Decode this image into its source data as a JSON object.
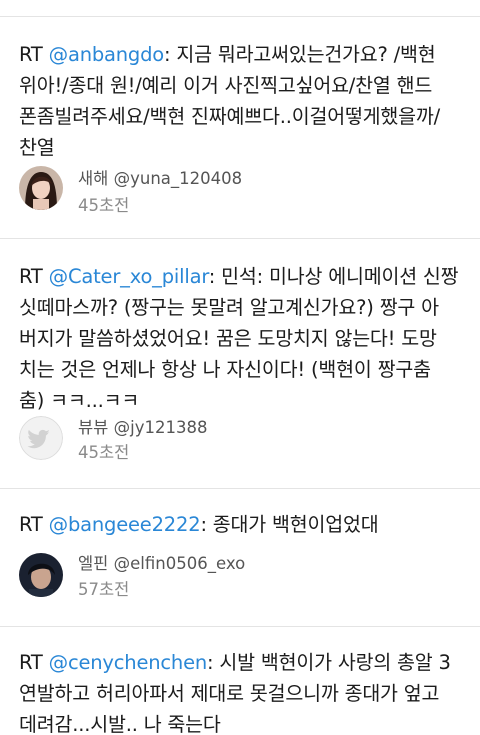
{
  "tweets": [
    {
      "prefix": "RT ",
      "mention": "@anbangdo",
      "lines_rest": ": 지금 뭐라고써있는건가요? /백현",
      "lines": [
        "위아!/종대 원!/예리 이거 사진찍고싶어요/찬열 핸드",
        "폰좀빌려주세요/백현 진짜예쁘다..이걸어떻게했을까/",
        "찬열"
      ],
      "display_name": "새해",
      "username": "@yuna_120408",
      "time": "45초전",
      "avatar": "girl-photo-avatar"
    },
    {
      "prefix": "RT ",
      "mention": "@Cater_xo_pillar",
      "lines_rest": ": 민석: 미나상 에니메이션 신짱",
      "lines": [
        "싯떼마스까? (짱구는 못말려 알고계신가요?) 짱구 아",
        "버지가 말씀하셨었어요! 꿈은 도망치지 않는다! 도망",
        "치는 것은 언제나 항상 나 자신이다! (백현이 짱구춤",
        "춤) ㅋㅋ...ㅋㅋ"
      ],
      "display_name": "뷰뷰",
      "username": "@jy121388",
      "time": "45초전",
      "avatar": "default-bird-avatar"
    },
    {
      "prefix": "RT ",
      "mention": "@bangeee2222",
      "lines_rest": ": 종대가 백현이업었대",
      "lines": [],
      "display_name": "엘핀",
      "username": "@elfin0506_exo",
      "time": "57초전",
      "avatar": "boy-photo-avatar"
    },
    {
      "prefix": "RT ",
      "mention": "@cenychenchen",
      "lines_rest": ": 시발 백현이가 사랑의 총알 3",
      "lines": [
        "연발하고 허리아파서 제대로 못걸으니까 종대가 엎고",
        "데려감...시발.. 나 죽는다"
      ],
      "display_name": "",
      "username": "",
      "time": "",
      "avatar": ""
    }
  ]
}
